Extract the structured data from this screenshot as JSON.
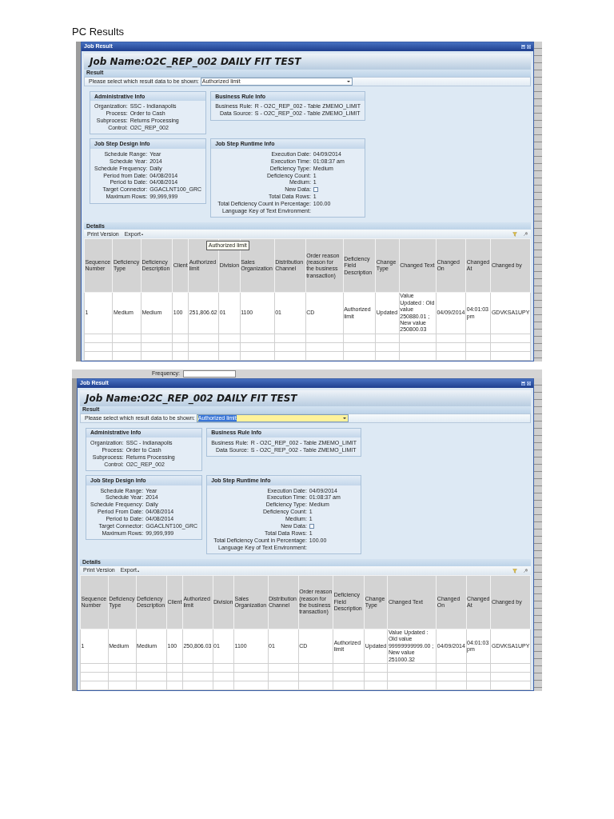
{
  "heading": "PC Results",
  "shots": [
    {
      "window_title": "Job Result",
      "job_name": "Job Name:O2C_REP_002 DAILY FIT TEST",
      "result_label": "Result",
      "select": {
        "label": "Please select which result data to be shown:",
        "value": "Authorized limit",
        "focused": false
      },
      "panels": [
        {
          "title": "Administrative Info",
          "fields": [
            {
              "label": "Organization:",
              "value": "SSC - Indianapolis"
            },
            {
              "label": "Process:",
              "value": "Order to Cash"
            },
            {
              "label": "Subprocess:",
              "value": "Returns Processing"
            },
            {
              "label": "Control:",
              "value": "O2C_REP_002"
            }
          ]
        },
        {
          "title": "Business Rule Info",
          "fields": [
            {
              "label": "Business Rule:",
              "value": "R - O2C_REP_002 - Table ZMEMO_LIMIT"
            },
            {
              "label": "Data Source:",
              "value": "S - O2C_REP_002 - Table ZMEMO_LIMIT"
            }
          ]
        },
        {
          "title": "Job Step Design Info",
          "fields": [
            {
              "label": "Schedule Range:",
              "value": "Year"
            },
            {
              "label": "Schedule Year:",
              "value": "2014"
            },
            {
              "label": "Schedule Frequency:",
              "value": "Daily"
            },
            {
              "label": "Period from Date:",
              "value": "04/08/2014"
            },
            {
              "label": "Period to Date:",
              "value": "04/08/2014"
            },
            {
              "label": "Target Connector:",
              "value": "GGACLNT100_GRC"
            },
            {
              "label": "Maximum Rows:",
              "value": "99,999,999"
            }
          ]
        },
        {
          "title": "Job Step Runtime Info",
          "fields": [
            {
              "label": "Execution Date:",
              "value": "04/09/2014",
              "kind": "text"
            },
            {
              "label": "Execution Time:",
              "value": "01:08:37 am",
              "kind": "text"
            },
            {
              "label": "Deficiency Type:",
              "value": "Medium",
              "kind": "text"
            },
            {
              "label": "Deficiency Count:",
              "value": "1",
              "kind": "text"
            },
            {
              "label": "Medium:",
              "value": "1",
              "kind": "text"
            },
            {
              "label": "New Data:",
              "kind": "checkbox",
              "checked": false
            },
            {
              "label": "Total Data Rows:",
              "value": "1",
              "kind": "text"
            },
            {
              "label": "Total Deficiency Count in Percentage:",
              "value": "100.00",
              "kind": "text"
            },
            {
              "label": "Language Key of Text Environment:",
              "kind": "text"
            }
          ]
        }
      ],
      "details": {
        "title": "Details",
        "toolbar": [
          "Print Version",
          "Export"
        ]
      },
      "table": {
        "columns": [
          "Sequence Number",
          "Deficiency Type",
          "Deficiency Description",
          "Client",
          "Authorized limit",
          "Division",
          "Sales Organization",
          "Distribution Channel",
          "Order reason (reason for the business transaction)",
          "Deficiency Field Description",
          "Change Type",
          "Changed Text",
          "Changed On",
          "Changed At",
          "Changed by"
        ],
        "rows": [
          [
            "1",
            "Medium",
            "Medium",
            "100",
            "251,806.62",
            "01",
            "1100",
            "01",
            "CD",
            "Authorized limit",
            "Updated",
            "Value Updated : Old value 250880.01 ; New value 250800.03",
            "04/09/2014",
            "04:01:03 pm",
            "GDVKSA1UPY"
          ]
        ]
      },
      "tooltip": "Authorized limit"
    },
    {
      "background": {
        "label": "Frequency:"
      },
      "window_title": "Job Result",
      "job_name": "Job Name:O2C_REP_002 DAILY FIT TEST",
      "result_label": "Result",
      "select": {
        "label": "Please select which result data to be shown:",
        "value": "Authorized limit",
        "focused": true
      },
      "panels": [
        {
          "title": "Administrative Info",
          "fields": [
            {
              "label": "Organization:",
              "value": "SSC - Indianapolis"
            },
            {
              "label": "Process:",
              "value": "Order to Cash"
            },
            {
              "label": "Subprocess:",
              "value": "Returns Processing"
            },
            {
              "label": "Control:",
              "value": "O2C_REP_002"
            }
          ]
        },
        {
          "title": "Business Rule Info",
          "fields": [
            {
              "label": "Business Rule:",
              "value": "R - O2C_REP_002 - Table ZMEMO_LIMIT"
            },
            {
              "label": "Data Source:",
              "value": "S - O2C_REP_002 - Table ZMEMO_LIMIT"
            }
          ]
        },
        {
          "title": "Job Step Design Info",
          "fields": [
            {
              "label": "Schedule Range:",
              "value": "Year"
            },
            {
              "label": "Schedule Year:",
              "value": "2014"
            },
            {
              "label": "Schedule Frequency:",
              "value": "Daily"
            },
            {
              "label": "Period From Date:",
              "value": "04/08/2014"
            },
            {
              "label": "Period to Date:",
              "value": "04/08/2014"
            },
            {
              "label": "Target Connector:",
              "value": "GGACLNT100_GRC"
            },
            {
              "label": "Maximum Rows:",
              "value": "99,999,999"
            }
          ]
        },
        {
          "title": "Job Step Runtime Info",
          "fields": [
            {
              "label": "Execution Date:",
              "value": "04/09/2014",
              "kind": "text"
            },
            {
              "label": "Execution Time:",
              "value": "01:08:37 am",
              "kind": "text"
            },
            {
              "label": "Deficiency Type:",
              "value": "Medium",
              "kind": "text"
            },
            {
              "label": "Deficiency Count:",
              "value": "1",
              "kind": "text"
            },
            {
              "label": "Medium:",
              "value": "1",
              "kind": "text"
            },
            {
              "label": "New Data:",
              "kind": "checkbox",
              "checked": false
            },
            {
              "label": "Total Data Rows:",
              "value": "1",
              "kind": "text"
            },
            {
              "label": "Total Deficiency Count in Percentage:",
              "value": "100.00",
              "kind": "text"
            },
            {
              "label": "Language Key of Text Environment:",
              "kind": "text"
            }
          ]
        }
      ],
      "details": {
        "title": "Details",
        "toolbar": [
          "Print Version",
          "Export"
        ]
      },
      "table": {
        "columns": [
          "Sequence Number",
          "Deficiency Type",
          "Deficiency Description",
          "Client",
          "Authorized limit",
          "Division",
          "Sales Organization",
          "Distribution Channel",
          "Order reason (reason for the business transaction)",
          "Deficiency Field Description",
          "Change Type",
          "Changed Text",
          "Changed On",
          "Changed At",
          "Changed by"
        ],
        "rows": [
          [
            "1",
            "Medium",
            "Medium",
            "100",
            "250,806.03",
            "01",
            "1100",
            "01",
            "CD",
            "Authorized limit",
            "Updated",
            "Value Updated : Old value 99999999999.00 ; New value 251000.32",
            "04/09/2014",
            "04:01:03 pm",
            "GDVKSA1UPY"
          ]
        ]
      }
    }
  ]
}
